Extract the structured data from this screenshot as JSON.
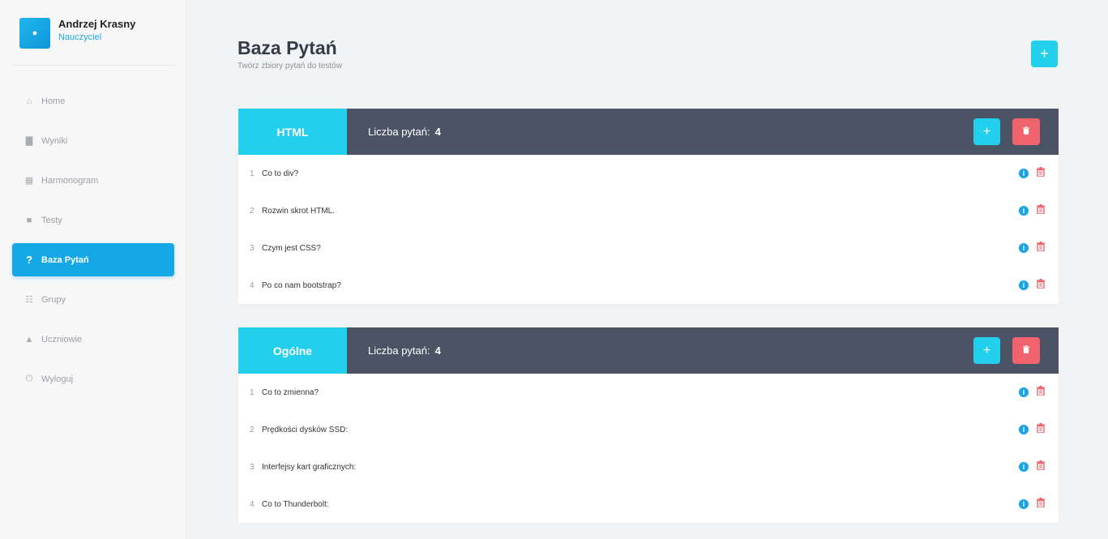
{
  "user": {
    "name": "Andrzej Krasny",
    "role": "Nauczyciel",
    "avatar_icon": "user-icon"
  },
  "nav": [
    {
      "label": "Home",
      "icon": "home-icon",
      "glyph": "⌂",
      "active": false
    },
    {
      "label": "Wyniki",
      "icon": "chart-icon",
      "glyph": "▇",
      "active": false
    },
    {
      "label": "Harmonogram",
      "icon": "calendar-icon",
      "glyph": "▦",
      "active": false
    },
    {
      "label": "Testy",
      "icon": "file-icon",
      "glyph": "■",
      "active": false
    },
    {
      "label": "Baza Pytań",
      "icon": "question-icon",
      "glyph": "?",
      "active": true
    },
    {
      "label": "Grupy",
      "icon": "group-icon",
      "glyph": "☷",
      "active": false
    },
    {
      "label": "Uczniowie",
      "icon": "student-icon",
      "glyph": "▲",
      "active": false
    },
    {
      "label": "Wyloguj",
      "icon": "power-icon",
      "glyph": "⏻",
      "active": false
    }
  ],
  "header": {
    "title": "Baza Pytań",
    "subtitle": "Twórz zbiory pytań do testów",
    "add_label": "+"
  },
  "count_label": "Liczba pytań:",
  "sets": [
    {
      "name": "HTML",
      "count": "4",
      "questions": [
        {
          "num": "1",
          "text": "Co to div?"
        },
        {
          "num": "2",
          "text": "Rozwin skrot HTML."
        },
        {
          "num": "3",
          "text": "Czym jest CSS?"
        },
        {
          "num": "4",
          "text": "Po co nam bootstrap?"
        }
      ]
    },
    {
      "name": "Ogólne",
      "count": "4",
      "questions": [
        {
          "num": "1",
          "text": "Co to zmienna?"
        },
        {
          "num": "2",
          "text": "Prędkości dysków SSD:"
        },
        {
          "num": "3",
          "text": "Interfejsy kart graficznych:"
        },
        {
          "num": "4",
          "text": "Co to Thunderbolt:"
        }
      ]
    }
  ],
  "colors": {
    "accent": "#22d0ee",
    "primary": "#16a7e6",
    "danger": "#f0626c",
    "header_bg": "#4a5464"
  }
}
